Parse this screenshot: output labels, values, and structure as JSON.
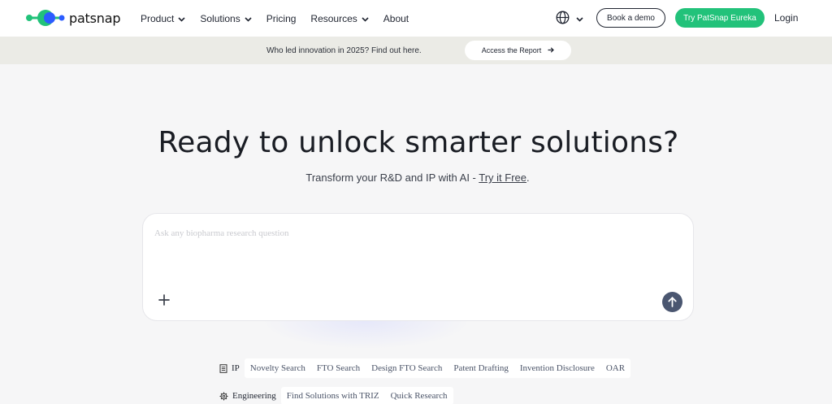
{
  "nav": {
    "logo_text": "patsnap",
    "menu": [
      {
        "label": "Product",
        "has_dropdown": true
      },
      {
        "label": "Solutions",
        "has_dropdown": true
      },
      {
        "label": "Pricing",
        "has_dropdown": false
      },
      {
        "label": "Resources",
        "has_dropdown": true
      },
      {
        "label": "About",
        "has_dropdown": false
      }
    ],
    "book_demo": "Book a demo",
    "try_eureka": "Try PatSnap Eureka",
    "login": "Login"
  },
  "banner": {
    "text": "Who led innovation in 2025? Find out here.",
    "button": "Access the Report"
  },
  "hero": {
    "title": "Ready to unlock smarter solutions?",
    "subtitle_prefix": "Transform your R&D and IP with AI - ",
    "subtitle_link": "Try it Free",
    "subtitle_suffix": "."
  },
  "search": {
    "placeholder": "Ask any biopharma research question",
    "value": ""
  },
  "chips": {
    "ip": {
      "label": "IP",
      "items": [
        "Novelty Search",
        "FTO Search",
        "Design FTO Search",
        "Patent Drafting",
        "Invention Disclosure",
        "OAR"
      ]
    },
    "engineering": {
      "label": "Engineering",
      "items": [
        "Find Solutions with TRIZ",
        "Quick Research"
      ]
    }
  },
  "colors": {
    "brand_green": "#22c27a",
    "brand_blue": "#2b5cff",
    "send_button": "#4a5670",
    "banner_bg": "#ebebe6"
  },
  "icons": {
    "globe": "globe-icon",
    "plus": "plus-icon",
    "send": "arrow-up-icon",
    "document": "document-icon",
    "gear": "gear-icon"
  }
}
